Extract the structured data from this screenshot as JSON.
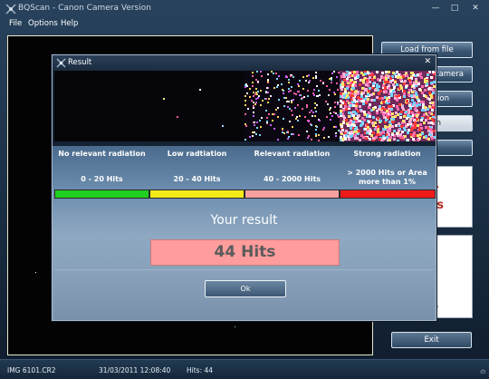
{
  "window": {
    "title": "BQScan - Canon Camera Version"
  },
  "menu": [
    "File",
    "Options",
    "Help"
  ],
  "side_buttons": {
    "load": "Load from file",
    "camera_fragment": "camera",
    "third_fragment": "ition",
    "fourth_fragment": "n",
    "card_text_1": "1",
    "card_text_2": "ts",
    "exit": "Exit"
  },
  "status": {
    "filename": "IMG 6101.CR2",
    "datetime": "31/03/2011 12:08:40",
    "hits": "Hits: 44"
  },
  "dialog": {
    "title": "Result",
    "categories": [
      {
        "name": "No relevant radiation",
        "range": "0 - 20 Hits",
        "color": "#20d020"
      },
      {
        "name": "Low radtiation",
        "range": "20 - 40 Hits",
        "color": "#f4ea18"
      },
      {
        "name": "Relevant radiation",
        "range": "40 - 2000 Hits",
        "color": "#f7a0a0"
      },
      {
        "name": "Strong radiation",
        "range_line1": "> 2000 Hits or Area",
        "range_line2": "more than 1%",
        "color": "#ee1b1b"
      }
    ],
    "result_label": "Your result",
    "result_value": "44 Hits",
    "ok": "Ok"
  },
  "colors": {
    "accent": "#ff9c9c",
    "background": "#1c3248"
  },
  "icons": {
    "app": "bqscan-logo-icon",
    "close": "close-icon",
    "minimize": "minimize-icon",
    "maximize": "maximize-icon",
    "magnifier": "magnifier-icon"
  }
}
